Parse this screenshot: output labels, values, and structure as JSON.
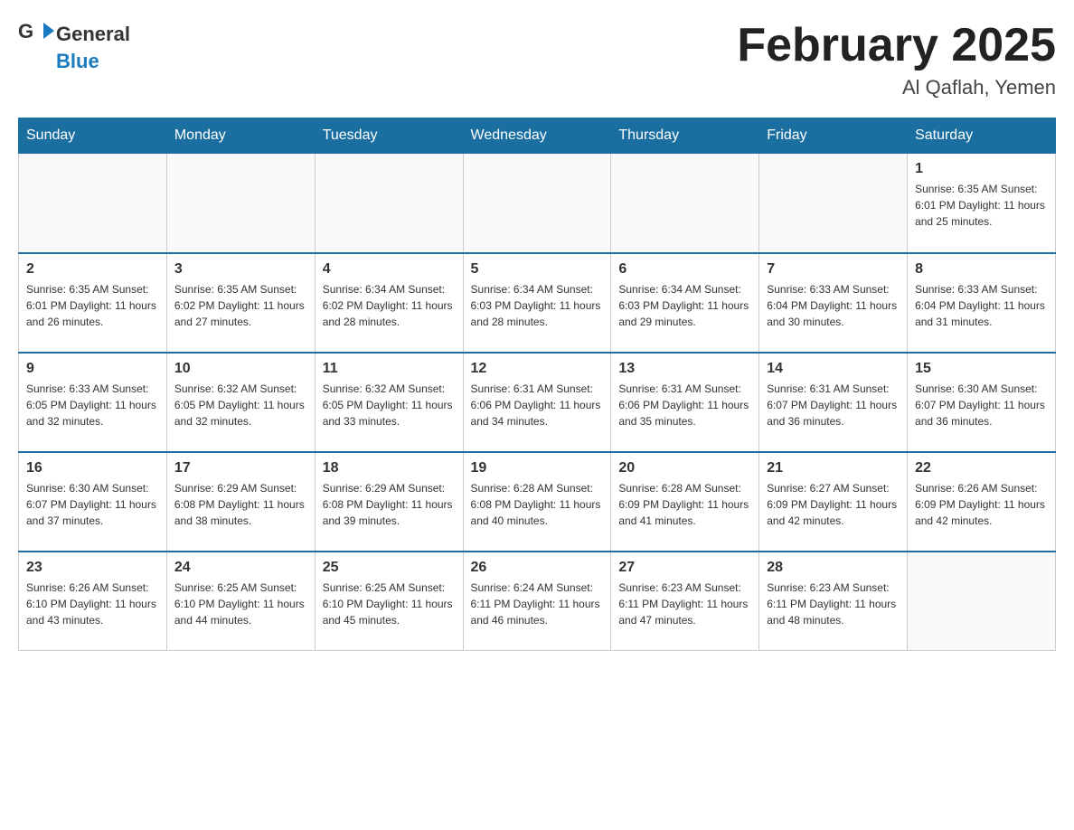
{
  "header": {
    "logo_general": "General",
    "logo_blue": "Blue",
    "month_title": "February 2025",
    "location": "Al Qaflah, Yemen"
  },
  "days_of_week": [
    "Sunday",
    "Monday",
    "Tuesday",
    "Wednesday",
    "Thursday",
    "Friday",
    "Saturday"
  ],
  "weeks": [
    {
      "days": [
        {
          "num": "",
          "info": ""
        },
        {
          "num": "",
          "info": ""
        },
        {
          "num": "",
          "info": ""
        },
        {
          "num": "",
          "info": ""
        },
        {
          "num": "",
          "info": ""
        },
        {
          "num": "",
          "info": ""
        },
        {
          "num": "1",
          "info": "Sunrise: 6:35 AM\nSunset: 6:01 PM\nDaylight: 11 hours\nand 25 minutes."
        }
      ]
    },
    {
      "days": [
        {
          "num": "2",
          "info": "Sunrise: 6:35 AM\nSunset: 6:01 PM\nDaylight: 11 hours\nand 26 minutes."
        },
        {
          "num": "3",
          "info": "Sunrise: 6:35 AM\nSunset: 6:02 PM\nDaylight: 11 hours\nand 27 minutes."
        },
        {
          "num": "4",
          "info": "Sunrise: 6:34 AM\nSunset: 6:02 PM\nDaylight: 11 hours\nand 28 minutes."
        },
        {
          "num": "5",
          "info": "Sunrise: 6:34 AM\nSunset: 6:03 PM\nDaylight: 11 hours\nand 28 minutes."
        },
        {
          "num": "6",
          "info": "Sunrise: 6:34 AM\nSunset: 6:03 PM\nDaylight: 11 hours\nand 29 minutes."
        },
        {
          "num": "7",
          "info": "Sunrise: 6:33 AM\nSunset: 6:04 PM\nDaylight: 11 hours\nand 30 minutes."
        },
        {
          "num": "8",
          "info": "Sunrise: 6:33 AM\nSunset: 6:04 PM\nDaylight: 11 hours\nand 31 minutes."
        }
      ]
    },
    {
      "days": [
        {
          "num": "9",
          "info": "Sunrise: 6:33 AM\nSunset: 6:05 PM\nDaylight: 11 hours\nand 32 minutes."
        },
        {
          "num": "10",
          "info": "Sunrise: 6:32 AM\nSunset: 6:05 PM\nDaylight: 11 hours\nand 32 minutes."
        },
        {
          "num": "11",
          "info": "Sunrise: 6:32 AM\nSunset: 6:05 PM\nDaylight: 11 hours\nand 33 minutes."
        },
        {
          "num": "12",
          "info": "Sunrise: 6:31 AM\nSunset: 6:06 PM\nDaylight: 11 hours\nand 34 minutes."
        },
        {
          "num": "13",
          "info": "Sunrise: 6:31 AM\nSunset: 6:06 PM\nDaylight: 11 hours\nand 35 minutes."
        },
        {
          "num": "14",
          "info": "Sunrise: 6:31 AM\nSunset: 6:07 PM\nDaylight: 11 hours\nand 36 minutes."
        },
        {
          "num": "15",
          "info": "Sunrise: 6:30 AM\nSunset: 6:07 PM\nDaylight: 11 hours\nand 36 minutes."
        }
      ]
    },
    {
      "days": [
        {
          "num": "16",
          "info": "Sunrise: 6:30 AM\nSunset: 6:07 PM\nDaylight: 11 hours\nand 37 minutes."
        },
        {
          "num": "17",
          "info": "Sunrise: 6:29 AM\nSunset: 6:08 PM\nDaylight: 11 hours\nand 38 minutes."
        },
        {
          "num": "18",
          "info": "Sunrise: 6:29 AM\nSunset: 6:08 PM\nDaylight: 11 hours\nand 39 minutes."
        },
        {
          "num": "19",
          "info": "Sunrise: 6:28 AM\nSunset: 6:08 PM\nDaylight: 11 hours\nand 40 minutes."
        },
        {
          "num": "20",
          "info": "Sunrise: 6:28 AM\nSunset: 6:09 PM\nDaylight: 11 hours\nand 41 minutes."
        },
        {
          "num": "21",
          "info": "Sunrise: 6:27 AM\nSunset: 6:09 PM\nDaylight: 11 hours\nand 42 minutes."
        },
        {
          "num": "22",
          "info": "Sunrise: 6:26 AM\nSunset: 6:09 PM\nDaylight: 11 hours\nand 42 minutes."
        }
      ]
    },
    {
      "days": [
        {
          "num": "23",
          "info": "Sunrise: 6:26 AM\nSunset: 6:10 PM\nDaylight: 11 hours\nand 43 minutes."
        },
        {
          "num": "24",
          "info": "Sunrise: 6:25 AM\nSunset: 6:10 PM\nDaylight: 11 hours\nand 44 minutes."
        },
        {
          "num": "25",
          "info": "Sunrise: 6:25 AM\nSunset: 6:10 PM\nDaylight: 11 hours\nand 45 minutes."
        },
        {
          "num": "26",
          "info": "Sunrise: 6:24 AM\nSunset: 6:11 PM\nDaylight: 11 hours\nand 46 minutes."
        },
        {
          "num": "27",
          "info": "Sunrise: 6:23 AM\nSunset: 6:11 PM\nDaylight: 11 hours\nand 47 minutes."
        },
        {
          "num": "28",
          "info": "Sunrise: 6:23 AM\nSunset: 6:11 PM\nDaylight: 11 hours\nand 48 minutes."
        },
        {
          "num": "",
          "info": ""
        }
      ]
    }
  ]
}
